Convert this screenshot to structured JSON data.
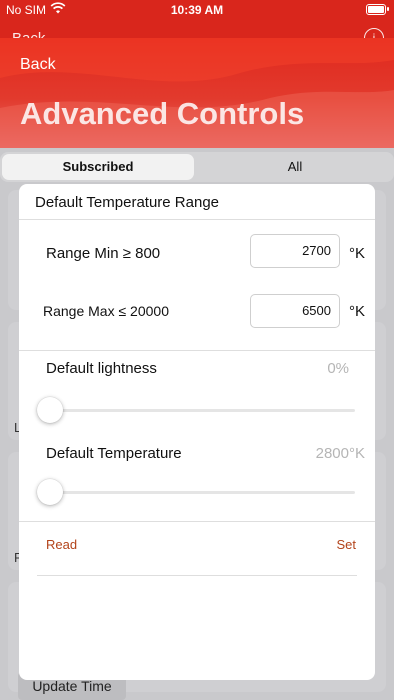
{
  "status_bar": {
    "carrier": "No SIM",
    "time": "10:39 AM"
  },
  "background_nav": {
    "back_label": "Back",
    "info_icon": "info-circle-icon"
  },
  "nav": {
    "back_label": "Back",
    "title": "Advanced Controls",
    "colors": {
      "primary": "#d9261c",
      "light": "#e86a68"
    }
  },
  "segmented": {
    "subscribed_label": "Subscribed",
    "all_label": "All",
    "selected": "Subscribed"
  },
  "background": {
    "label_l": "L",
    "label_r": "R",
    "update_button": "Update Time"
  },
  "sheet": {
    "title": "Default Temperature Range",
    "range_min": {
      "label": "Range Min ≥ 800",
      "value": "2700",
      "unit": "°K"
    },
    "range_max": {
      "label": "Range Max ≤ 20000",
      "value": "6500",
      "unit": "°K"
    },
    "lightness": {
      "label": "Default lightness",
      "value": "0%",
      "slider_fraction": 0
    },
    "temperature": {
      "label": "Default Temperature",
      "value": "2800°K",
      "slider_fraction": 0
    },
    "read_label": "Read",
    "set_label": "Set",
    "accent_color": "#b3431a"
  }
}
